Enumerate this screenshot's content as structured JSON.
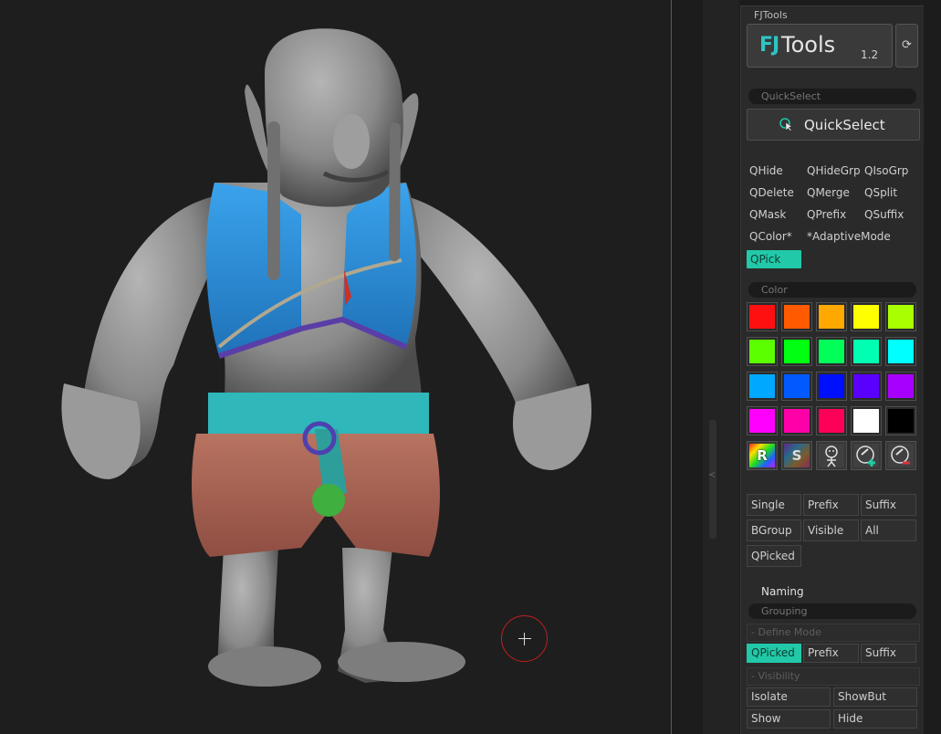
{
  "panel": {
    "title": "FJTools",
    "logo": {
      "fj": "FJ",
      "name": "Tools",
      "version": "1.2"
    },
    "swap_icon": "refresh-icon"
  },
  "quickselect": {
    "header": "QuickSelect",
    "button_label": "QuickSelect",
    "commands": [
      [
        "QHide",
        "QHideGrp",
        "QIsoGrp"
      ],
      [
        "QDelete",
        "QMerge",
        "QSplit"
      ],
      [
        "QMask",
        "QPrefix",
        "QSuffix"
      ],
      [
        "QColor*",
        "*AdaptiveMode"
      ]
    ],
    "active": "QPick"
  },
  "color": {
    "header": "Color",
    "swatches": [
      [
        "#ff1010",
        "#ff5a00",
        "#ffa800",
        "#ffff00",
        "#a8ff00"
      ],
      [
        "#5cff00",
        "#00ff10",
        "#00ff58",
        "#00ffb0",
        "#00ffff"
      ],
      [
        "#00a8ff",
        "#005aff",
        "#0010ff",
        "#5a00ff",
        "#a800ff"
      ],
      [
        "#ff00ff",
        "#ff00a8",
        "#ff0058",
        "#ffffff",
        "#000000"
      ]
    ],
    "tools": [
      {
        "label": "R",
        "icon": "rainbow-random-icon"
      },
      {
        "label": "S",
        "icon": "rainbow-select-icon"
      },
      {
        "label": "",
        "icon": "stick-figure-icon"
      },
      {
        "label": "",
        "icon": "eyedropper-add-icon"
      },
      {
        "label": "",
        "icon": "eyedropper-remove-icon"
      }
    ]
  },
  "select_mode": {
    "row1": [
      "Single",
      "Prefix",
      "Suffix"
    ],
    "row2": [
      "BGroup",
      "Visible",
      "All"
    ],
    "row3": [
      "QPicked"
    ]
  },
  "naming": "Naming",
  "grouping": {
    "header": "Grouping",
    "define_mode": "- Define Mode",
    "define_buttons": [
      "QPicked",
      "Prefix",
      "Suffix"
    ],
    "define_active": "QPicked",
    "visibility": "- Visibility",
    "vis_row1": [
      "Isolate",
      "ShowBut"
    ],
    "vis_row2": [
      "Show",
      "Hide"
    ]
  },
  "colors": {
    "accent": "#22c9a8",
    "brush_ring": "#c21f1f",
    "skin": "#8f8f8f",
    "vest": "#2b8ed8",
    "belt": "#2fb7b9",
    "pants": "#b06a5a"
  }
}
